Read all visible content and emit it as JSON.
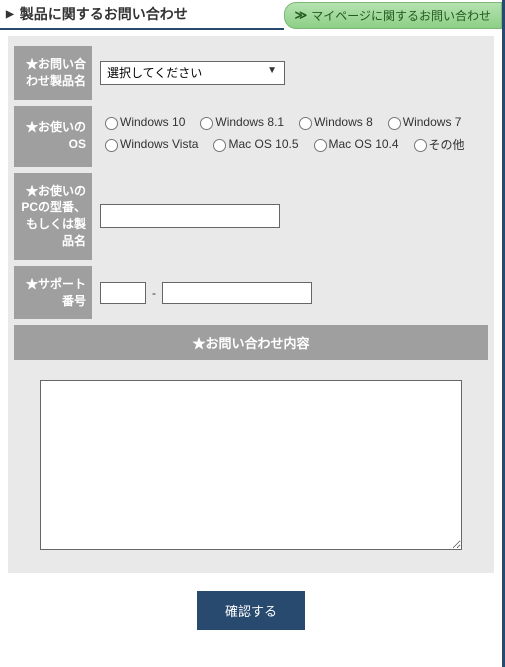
{
  "header": {
    "title": "製品に関するお問い合わせ",
    "mypage_link": "マイページに関するお問い合わせ"
  },
  "labels": {
    "product_name": "★お問い合わせ製品名",
    "os": "★お使いのOS",
    "pc_model": "★お使いのPCの型番、もしくは製品名",
    "support_no": "★サポート番号",
    "content": "★お問い合わせ内容"
  },
  "product_select": {
    "placeholder": "選択してください"
  },
  "os_options": [
    "Windows 10",
    "Windows 8.1",
    "Windows 8",
    "Windows 7",
    "Windows Vista",
    "Mac OS 10.5",
    "Mac OS 10.4",
    "その他"
  ],
  "support_no": {
    "part1": "",
    "part2": "",
    "dash": "-"
  },
  "pc_model_value": "",
  "content_value": "",
  "submit_label": "確認する"
}
